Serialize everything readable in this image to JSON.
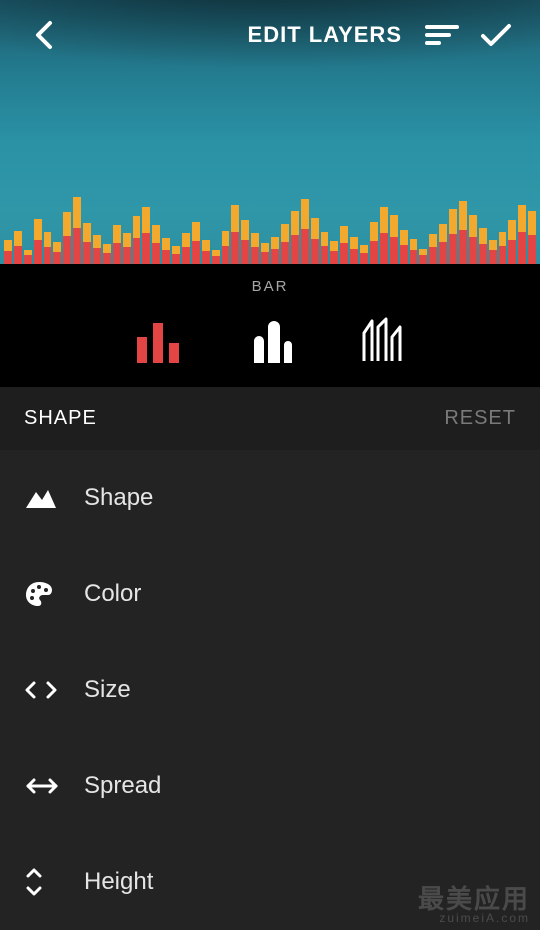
{
  "header": {
    "title": "EDIT LAYERS"
  },
  "strip": {
    "label": "BAR",
    "options": [
      {
        "name": "bar-plain",
        "selected": true
      },
      {
        "name": "bar-rounded",
        "selected": false
      },
      {
        "name": "bar-outline",
        "selected": false
      }
    ]
  },
  "section": {
    "label": "SHAPE",
    "reset": "RESET"
  },
  "list": {
    "items": [
      {
        "icon": "shape-icon",
        "label": "Shape"
      },
      {
        "icon": "palette-icon",
        "label": "Color"
      },
      {
        "icon": "size-icon",
        "label": "Size"
      },
      {
        "icon": "spread-icon",
        "label": "Spread"
      },
      {
        "icon": "height-icon",
        "label": "Height"
      }
    ]
  },
  "colors": {
    "accent": "#e34545",
    "accent2": "#f2a92e"
  },
  "watermark": {
    "line1": "最美应用",
    "line2": "zuimeiA.com"
  },
  "equalizer": {
    "bars": [
      [
        11,
        13
      ],
      [
        15,
        18
      ],
      [
        5,
        9
      ],
      [
        21,
        24
      ],
      [
        15,
        17
      ],
      [
        10,
        12
      ],
      [
        24,
        28
      ],
      [
        31,
        36
      ],
      [
        19,
        22
      ],
      [
        13,
        16
      ],
      [
        9,
        11
      ],
      [
        18,
        21
      ],
      [
        14,
        17
      ],
      [
        22,
        26
      ],
      [
        26,
        31
      ],
      [
        18,
        21
      ],
      [
        12,
        14
      ],
      [
        8,
        10
      ],
      [
        14,
        17
      ],
      [
        19,
        23
      ],
      [
        11,
        13
      ],
      [
        6,
        8
      ],
      [
        15,
        18
      ],
      [
        27,
        32
      ],
      [
        20,
        24
      ],
      [
        14,
        17
      ],
      [
        9,
        12
      ],
      [
        12,
        15
      ],
      [
        18,
        22
      ],
      [
        24,
        29
      ],
      [
        30,
        35
      ],
      [
        21,
        25
      ],
      [
        14,
        18
      ],
      [
        10,
        13
      ],
      [
        17,
        21
      ],
      [
        12,
        15
      ],
      [
        8,
        11
      ],
      [
        19,
        23
      ],
      [
        26,
        31
      ],
      [
        22,
        27
      ],
      [
        15,
        19
      ],
      [
        11,
        14
      ],
      [
        6,
        9
      ],
      [
        13,
        17
      ],
      [
        18,
        22
      ],
      [
        25,
        30
      ],
      [
        29,
        34
      ],
      [
        22,
        27
      ],
      [
        16,
        20
      ],
      [
        10,
        14
      ],
      [
        14,
        18
      ],
      [
        20,
        24
      ],
      [
        27,
        32
      ],
      [
        24,
        29
      ]
    ]
  }
}
